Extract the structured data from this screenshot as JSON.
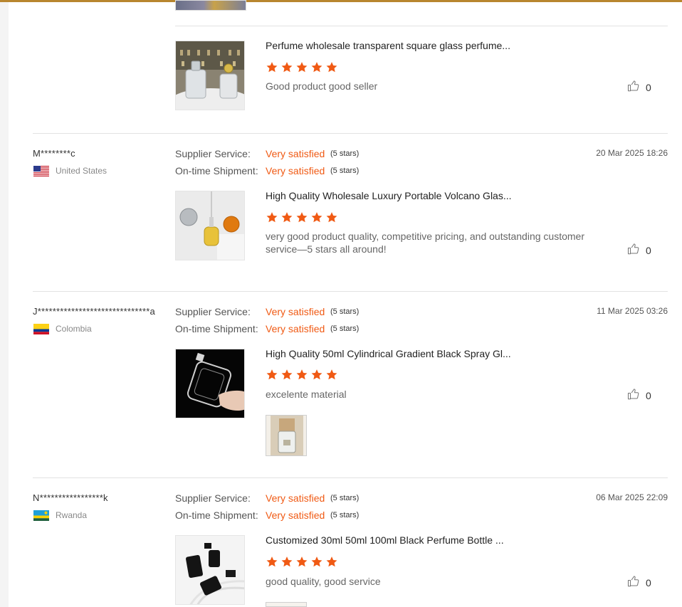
{
  "labels": {
    "supplier_service": "Supplier Service:",
    "ontime_shipment": "On-time Shipment:"
  },
  "reviews": [
    {
      "product_title": "Perfume wholesale transparent square glass perfume...",
      "rating": 5,
      "comment": "Good product good seller",
      "likes": "0"
    },
    {
      "reviewer": "M********c",
      "country": "United States",
      "date": "20 Mar 2025 18:26",
      "supplier_service": "Very satisfied",
      "supplier_stars": "(5 stars)",
      "shipment": "Very satisfied",
      "shipment_stars": "(5 stars)",
      "product_title": "High Quality Wholesale Luxury Portable Volcano Glas...",
      "rating": 5,
      "comment": "very good product quality, competitive pricing, and outstanding customer service—5 stars all around!",
      "likes": "0"
    },
    {
      "reviewer": "J******************************a",
      "country": "Colombia",
      "date": "11 Mar 2025 03:26",
      "supplier_service": "Very satisfied",
      "supplier_stars": "(5 stars)",
      "shipment": "Very satisfied",
      "shipment_stars": "(5 stars)",
      "product_title": "High Quality 50ml Cylindrical Gradient Black Spray Gl...",
      "rating": 5,
      "comment": "excelente material",
      "likes": "0"
    },
    {
      "reviewer": "N*****************k",
      "country": "Rwanda",
      "date": "06 Mar 2025 22:09",
      "supplier_service": "Very satisfied",
      "supplier_stars": "(5 stars)",
      "shipment": "Very satisfied",
      "shipment_stars": "(5 stars)",
      "product_title": "Customized 30ml 50ml 100ml Black Perfume Bottle ...",
      "rating": 5,
      "comment": "good quality, good service",
      "likes": "0"
    }
  ],
  "colors": {
    "accent": "#f05a14",
    "top_border": "#b8862f",
    "separator": "#e2e2e2"
  },
  "icons": {
    "star": "star-icon",
    "like": "thumbs-up-icon",
    "flags": [
      "us-flag-icon",
      "colombia-flag-icon",
      "rwanda-flag-icon"
    ]
  }
}
